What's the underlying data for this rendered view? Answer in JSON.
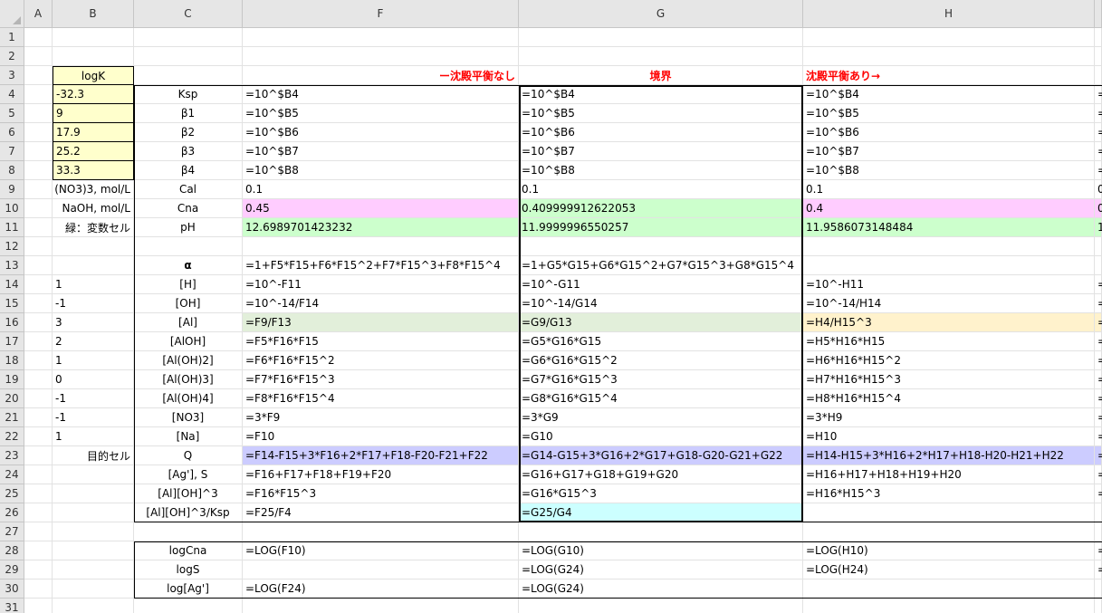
{
  "columns": [
    "A",
    "B",
    "C",
    "F",
    "G",
    "H"
  ],
  "rows": [
    "1",
    "2",
    "3",
    "4",
    "5",
    "6",
    "7",
    "8",
    "9",
    "10",
    "11",
    "12",
    "13",
    "14",
    "15",
    "16",
    "17",
    "18",
    "19",
    "20",
    "21",
    "22",
    "23",
    "24",
    "25",
    "26",
    "27",
    "28",
    "29",
    "30",
    "31"
  ],
  "colorsKey": {
    "yellow": "#ffffcc",
    "pink": "#ffccff",
    "green": "#ccffcc",
    "lightGreen": "#e2efda",
    "orange": "#fff2cc",
    "purple": "#ccccff",
    "cyan": "#ccffff",
    "red": "#ff0000"
  },
  "headers": {
    "F": "ー沈殿平衡なし",
    "G": "境界",
    "H": "沈殿平衡あり→"
  },
  "colB": {
    "r3": "logK",
    "r4": "-32.3",
    "r5": "9",
    "r6": "17.9",
    "r7": "25.2",
    "r8": "33.3",
    "r9": "(NO3)3, mol/L",
    "r10": "NaOH, mol/L",
    "r11": "緑：変数セル",
    "r14": "1",
    "r15": "-1",
    "r16": "3",
    "r17": "2",
    "r18": "1",
    "r19": "0",
    "r20": "-1",
    "r21": "-1",
    "r22": "1",
    "r23": "目的セル"
  },
  "colC": {
    "r4": "Ksp",
    "r5": "β1",
    "r6": "β2",
    "r7": "β3",
    "r8": "β4",
    "r9": "Cal",
    "r10": "Cna",
    "r11": "pH",
    "r13": "α",
    "r14": "[H]",
    "r15": "[OH]",
    "r16": "[Al]",
    "r17": "[AlOH]",
    "r18": "[Al(OH)2]",
    "r19": "[Al(OH)3]",
    "r20": "[Al(OH)4]",
    "r21": "[NO3]",
    "r22": "[Na]",
    "r23": "Q",
    "r24": "[Ag'], S",
    "r25": "[Al][OH]^3",
    "r26": "[Al][OH]^3/Ksp",
    "r28": "logCna",
    "r29": "logS",
    "r30": "log[Ag']"
  },
  "colF": {
    "r4": "=10^$B4",
    "r5": "=10^$B5",
    "r6": "=10^$B6",
    "r7": "=10^$B7",
    "r8": "=10^$B8",
    "r9": "0.1",
    "r10": "0.45",
    "r11": "12.6989701423232",
    "r13": "=1+F5*F15+F6*F15^2+F7*F15^3+F8*F15^4",
    "r14": "=10^-F11",
    "r15": "=10^-14/F14",
    "r16": "=F9/F13",
    "r17": "=F5*F16*F15",
    "r18": "=F6*F16*F15^2",
    "r19": "=F7*F16*F15^3",
    "r20": "=F8*F16*F15^4",
    "r21": "=3*F9",
    "r22": "=F10",
    "r23": "=F14-F15+3*F16+2*F17+F18-F20-F21+F22",
    "r24": "=F16+F17+F18+F19+F20",
    "r25": "=F16*F15^3",
    "r26": "=F25/F4",
    "r28": "=LOG(F10)",
    "r29": "",
    "r30": "=LOG(F24)"
  },
  "colG": {
    "r4": "=10^$B4",
    "r5": "=10^$B5",
    "r6": "=10^$B6",
    "r7": "=10^$B7",
    "r8": "=10^$B8",
    "r9": "0.1",
    "r10": "0.409999912622053",
    "r11": "11.9999996550257",
    "r13": "=1+G5*G15+G6*G15^2+G7*G15^3+G8*G15^4",
    "r14": "=10^-G11",
    "r15": "=10^-14/G14",
    "r16": "=G9/G13",
    "r17": "=G5*G16*G15",
    "r18": "=G6*G16*G15^2",
    "r19": "=G7*G16*G15^3",
    "r20": "=G8*G16*G15^4",
    "r21": "=3*G9",
    "r22": "=G10",
    "r23": "=G14-G15+3*G16+2*G17+G18-G20-G21+G22",
    "r24": "=G16+G17+G18+G19+G20",
    "r25": "=G16*G15^3",
    "r26": "=G25/G4",
    "r28": "=LOG(G10)",
    "r29": "=LOG(G24)",
    "r30": "=LOG(G24)"
  },
  "colH": {
    "r4": "=10^$B4",
    "r5": "=10^$B5",
    "r6": "=10^$B6",
    "r7": "=10^$B7",
    "r8": "=10^$B8",
    "r9": "0.1",
    "r10": "0.4",
    "r11": "11.9586073148484",
    "r13": "",
    "r14": "=10^-H11",
    "r15": "=10^-14/H14",
    "r16": "=H4/H15^3",
    "r17": "=H5*H16*H15",
    "r18": "=H6*H16*H15^2",
    "r19": "=H7*H16*H15^3",
    "r20": "=H8*H16*H15^4",
    "r21": "=3*H9",
    "r22": "=H10",
    "r23": "=H14-H15+3*H16+2*H17+H18-H20-H21+H22",
    "r24": "=H16+H17+H18+H19+H20",
    "r25": "=H16*H15^3",
    "r26": "",
    "r28": "=LOG(H10)",
    "r29": "=LOG(H24)",
    "r30": ""
  },
  "colNext": {
    "r4": "=",
    "r5": "=",
    "r6": "=",
    "r7": "=",
    "r8": "=",
    "r9": "0",
    "r10": "0",
    "r11": "1",
    "r14": "=",
    "r15": "=",
    "r16": "=",
    "r17": "=",
    "r18": "=",
    "r19": "=",
    "r20": "=",
    "r21": "=",
    "r22": "=",
    "r23": "=",
    "r24": "=",
    "r25": "=",
    "r28": "=",
    "r29": "="
  }
}
